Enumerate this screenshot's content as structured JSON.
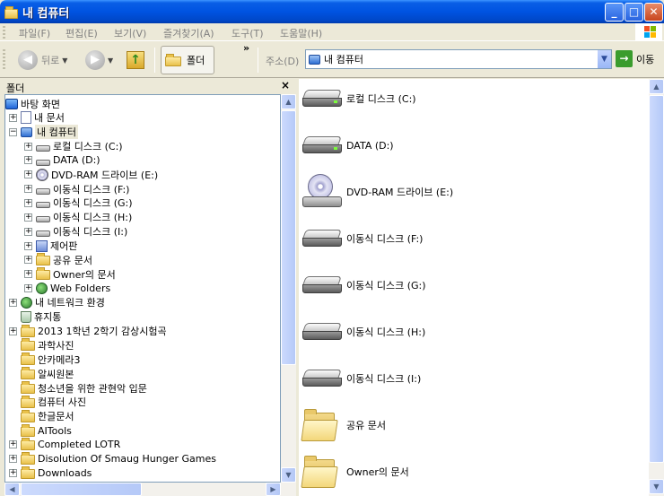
{
  "window": {
    "title": "내 컴퓨터",
    "min": "_",
    "max": "□",
    "close": "✕"
  },
  "menu": [
    "파일(F)",
    "편집(E)",
    "보기(V)",
    "즐겨찾기(A)",
    "도구(T)",
    "도움말(H)"
  ],
  "toolbar": {
    "back_label": "뒤로",
    "forward_glyph": "▶",
    "back_glyph": "◀",
    "up_glyph": "↑",
    "folders_label": "폴더",
    "overflow": "»",
    "address_label": "주소(D)",
    "address_value": "내 컴퓨터",
    "go_label": "이동",
    "go_glyph": "→"
  },
  "folder_pane": {
    "title": "폴더",
    "close": "×",
    "tree": [
      {
        "label": "바탕 화면",
        "icon": "desk",
        "level": 0,
        "exp": "none"
      },
      {
        "label": "내 문서",
        "icon": "doc",
        "level": 1,
        "exp": "plus"
      },
      {
        "label": "내 컴퓨터",
        "icon": "pc",
        "level": 1,
        "exp": "minus",
        "selected": true
      },
      {
        "label": "로컬 디스크 (C:)",
        "icon": "drive",
        "level": 2,
        "exp": "plus"
      },
      {
        "label": "DATA (D:)",
        "icon": "drive",
        "level": 2,
        "exp": "plus"
      },
      {
        "label": "DVD-RAM 드라이브 (E:)",
        "icon": "cd",
        "level": 2,
        "exp": "plus"
      },
      {
        "label": "이동식 디스크 (F:)",
        "icon": "drive",
        "level": 2,
        "exp": "plus"
      },
      {
        "label": "이동식 디스크 (G:)",
        "icon": "drive",
        "level": 2,
        "exp": "plus"
      },
      {
        "label": "이동식 디스크 (H:)",
        "icon": "drive",
        "level": 2,
        "exp": "plus"
      },
      {
        "label": "이동식 디스크 (I:)",
        "icon": "drive",
        "level": 2,
        "exp": "plus"
      },
      {
        "label": "제어판",
        "icon": "ctrl",
        "level": 2,
        "exp": "plus"
      },
      {
        "label": "공유 문서",
        "icon": "folder",
        "level": 2,
        "exp": "plus"
      },
      {
        "label": "Owner의 문서",
        "icon": "folder",
        "level": 2,
        "exp": "plus"
      },
      {
        "label": "Web Folders",
        "icon": "net",
        "level": 2,
        "exp": "plus"
      },
      {
        "label": "내 네트워크 환경",
        "icon": "net",
        "level": 1,
        "exp": "plus"
      },
      {
        "label": "휴지통",
        "icon": "trash",
        "level": 1,
        "exp": "none"
      },
      {
        "label": "2013 1학년 2학기 감상시험곡",
        "icon": "folder",
        "level": 1,
        "exp": "plus"
      },
      {
        "label": "과학사진",
        "icon": "folder",
        "level": 1,
        "exp": "none"
      },
      {
        "label": "안카메라3",
        "icon": "folder",
        "level": 1,
        "exp": "none"
      },
      {
        "label": "알씨원본",
        "icon": "folder",
        "level": 1,
        "exp": "none"
      },
      {
        "label": "청소년을 위한 관현악 입문",
        "icon": "folder",
        "level": 1,
        "exp": "none"
      },
      {
        "label": "컴퓨터 사진",
        "icon": "folder",
        "level": 1,
        "exp": "none"
      },
      {
        "label": "한글문서",
        "icon": "folder",
        "level": 1,
        "exp": "none"
      },
      {
        "label": "AITools",
        "icon": "folder",
        "level": 1,
        "exp": "none"
      },
      {
        "label": "Completed LOTR",
        "icon": "folder",
        "level": 1,
        "exp": "plus"
      },
      {
        "label": "Disolution Of Smaug Hunger Games",
        "icon": "folder",
        "level": 1,
        "exp": "plus"
      },
      {
        "label": "Downloads",
        "icon": "folder",
        "level": 1,
        "exp": "plus"
      }
    ]
  },
  "content": {
    "items": [
      {
        "label": "로컬 디스크 (C:)",
        "icon": "hdd"
      },
      {
        "label": "DATA (D:)",
        "icon": "hdd"
      },
      {
        "label": "DVD-RAM 드라이브 (E:)",
        "icon": "cd"
      },
      {
        "label": "이동식 디스크 (F:)",
        "icon": "removable"
      },
      {
        "label": "이동식 디스크 (G:)",
        "icon": "removable"
      },
      {
        "label": "이동식 디스크 (H:)",
        "icon": "removable"
      },
      {
        "label": "이동식 디스크 (I:)",
        "icon": "removable"
      },
      {
        "label": "공유 문서",
        "icon": "folder"
      },
      {
        "label": "Owner의 문서",
        "icon": "folder"
      }
    ]
  },
  "scroll": {
    "up": "▲",
    "down": "▼",
    "expand_plus": "+",
    "expand_minus": "−"
  }
}
